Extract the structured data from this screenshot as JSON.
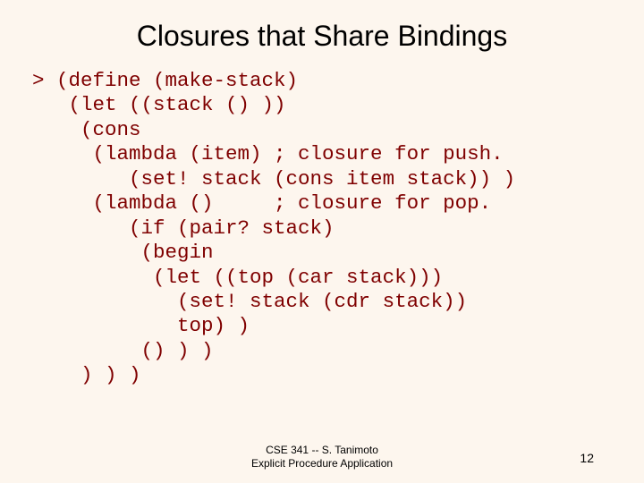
{
  "title": "Closures that Share Bindings",
  "code": "> (define (make-stack)\n   (let ((stack () ))\n    (cons\n     (lambda (item) ; closure for push.\n        (set! stack (cons item stack)) )\n     (lambda ()     ; closure for pop.\n        (if (pair? stack)\n         (begin\n          (let ((top (car stack)))\n            (set! stack (cdr stack))\n            top) )\n         () ) )\n    ) ) )",
  "footer_line1": "CSE 341 -- S. Tanimoto",
  "footer_line2": "Explicit Procedure Application",
  "page_number": "12"
}
